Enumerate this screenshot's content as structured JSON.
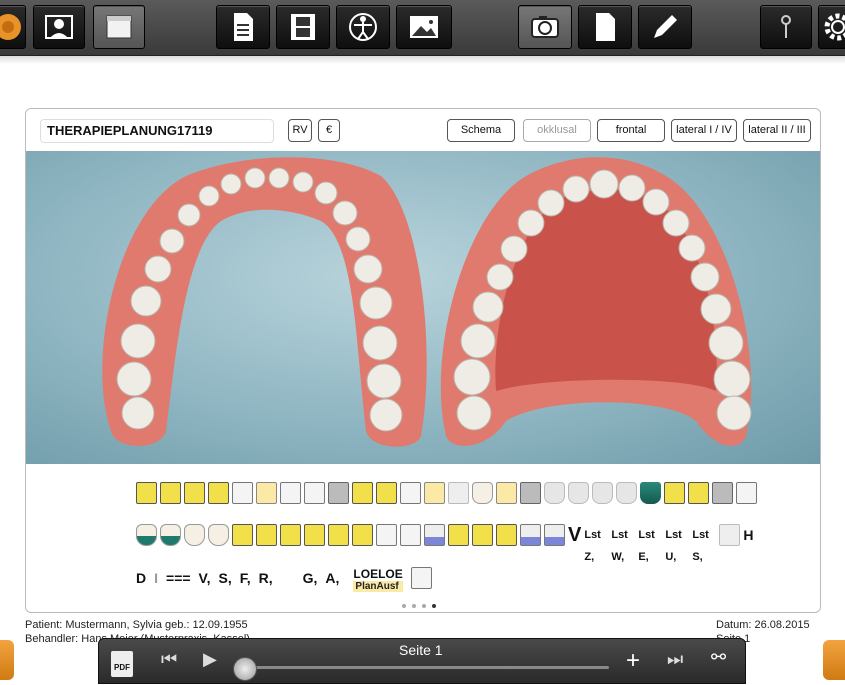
{
  "toolbar": {
    "icons": [
      "app-logo-icon",
      "patient-icon",
      "folder-icon",
      "document-icon",
      "film-icon",
      "vitruvian-icon",
      "image-icon",
      "camera-icon",
      "blank-page-icon",
      "pencil-icon",
      "pin-icon",
      "gear-icon"
    ]
  },
  "panel": {
    "title": "THERAPIEPLANUNG17119",
    "small_buttons": [
      "RV",
      "€"
    ],
    "view_buttons": [
      "Schema",
      "okklusal",
      "frontal",
      "lateral I / IV",
      "lateral II / III"
    ]
  },
  "palette": {
    "row3_labels": [
      "D",
      "I",
      "===",
      "V,",
      "S,",
      "F,",
      "R,",
      "G,",
      "A,",
      "LOELOE",
      "PlanAusf"
    ],
    "row2_labels": [
      "V",
      "Lst Z,",
      "Lst W,",
      "Lst E,",
      "Lst U,",
      "Lst S,",
      "H"
    ],
    "page_dots": 4,
    "active_dot": 4
  },
  "footer": {
    "patient": "Patient: Mustermann, Sylvia geb.: 12.09.1955",
    "behandler": "Behandler: Hans Meier (Musterpraxis, Kassel)",
    "datum": "Datum: 26.08.2015",
    "seite_right": "Seite 1"
  },
  "player": {
    "page_label": "Seite 1",
    "pdf_label": "PDF"
  },
  "colors": {
    "toolbar": "#3a3a3a",
    "accent_orange": "#e8922a",
    "gum": "#e07a6e",
    "background_scene": "#8fb6c2"
  }
}
